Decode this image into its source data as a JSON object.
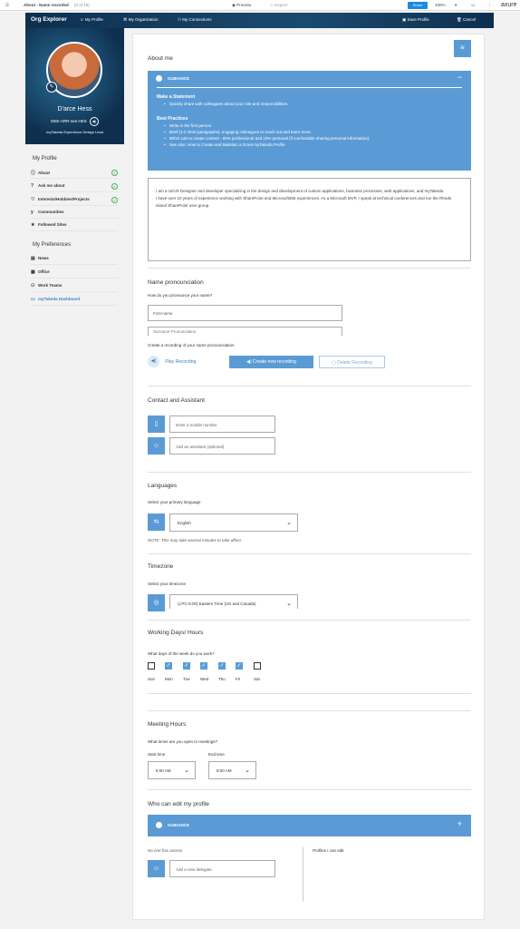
{
  "axure": {
    "page_title": "About - Name recorded",
    "page_count": "(3 of 16)",
    "preview": "Preview",
    "inspect": "Inspect",
    "share": "Share",
    "zoom": "100%",
    "logo": "axure"
  },
  "app": {
    "brand": "Org Explorer",
    "nav": [
      "My Profile",
      "My Organization",
      "My Connections"
    ],
    "save": "Save Profile",
    "cancel": "Cancel"
  },
  "profile": {
    "name": "D'arce Hess",
    "pronunciation": "DEE-ARR-see HES",
    "title": "myTakeda Experience Design Lead"
  },
  "sidebar": {
    "my_profile": "My Profile",
    "profile_items": [
      {
        "label": "About",
        "icon": "info-icon",
        "done": true
      },
      {
        "label": "Ask me about",
        "icon": "question-icon",
        "done": true
      },
      {
        "label": "Interests/Hobbies/Projects",
        "icon": "heart-icon",
        "done": true
      },
      {
        "label": "Communities",
        "icon": "yammer-icon",
        "done": false
      },
      {
        "label": "Followed Sites",
        "icon": "star-icon",
        "done": false
      }
    ],
    "my_preferences": "My Preferences",
    "pref_items": [
      {
        "label": "News",
        "icon": "news-icon"
      },
      {
        "label": "Office",
        "icon": "office-icon"
      },
      {
        "label": "Work Teams",
        "icon": "teams-icon"
      },
      {
        "label": "myTakeda Dashboard",
        "icon": "dashboard-icon"
      }
    ]
  },
  "about": {
    "heading": "About me",
    "guidance_title": "GUIDANCE",
    "make_statement": "Make a Statement",
    "statement_bullets": [
      "Quickly share with colleagues about your role and responsibilities."
    ],
    "best_practices": "Best Practices",
    "practice_bullets": [
      "Write in the first person.",
      "Brief (1-2 short paragraphs), engaging colleagues to reach out and learn more.",
      "90/10 rule to create content - 90% professional and 10% personal (if comfortable sharing personal information).",
      "See also: How to Create and Maintain a Great myTakeda Profile"
    ],
    "text": "I am a UI/UX Designer and developer specializing in the design and development of custom applications, business processes, web applications, and myTakeda.\nI have over 10 years of experience working with SharePoint and Microsoft365 experiences. As a Microsoft MVP, I speak at technical conferences and run the Rhode Island SharePoint user group."
  },
  "pronunciation": {
    "heading": "Name pronounciation",
    "question": "How do you pronounce your name?",
    "first_placeholder": "First-name",
    "surname_placeholder": "Surname-Pronunciation",
    "recording_label": "Create a recording of your name pronounciation",
    "play": "Play Recording",
    "create": "Create new recording",
    "delete": "Delete Recording"
  },
  "contact": {
    "heading": "Contact and Assistant",
    "mobile_placeholder": "Enter a mobile number",
    "assistant_placeholder": "Add an assistant (optional)"
  },
  "languages": {
    "heading": "Languages",
    "label": "Select your primary language",
    "value": "English",
    "note": "NOTE: This may take several minutes to take affect."
  },
  "timezone": {
    "heading": "Timezone",
    "label": "Select your timezone",
    "value": "(UTC-5:00) Eastern Time (US and Canada)"
  },
  "working": {
    "heading": "Working Days/ Hours",
    "question": "What days of the week do you work?",
    "days": [
      {
        "label": "Sun",
        "checked": false
      },
      {
        "label": "Mon",
        "checked": true
      },
      {
        "label": "Tue",
        "checked": true
      },
      {
        "label": "Wed",
        "checked": true
      },
      {
        "label": "Thu",
        "checked": true
      },
      {
        "label": "Fri",
        "checked": true
      },
      {
        "label": "Sat",
        "checked": false
      }
    ]
  },
  "meeting": {
    "heading": "Meeting Hours",
    "question": "What times are you open to meetings?",
    "start_label": "Start time",
    "start_value": "8:00 AM",
    "end_label": "End time",
    "end_value": "8:00 AM"
  },
  "editors": {
    "heading": "Who can edit my profile",
    "guidance_title": "GUIDANCE",
    "no_access": "No one has access",
    "delegate_placeholder": "Add a new delegate",
    "profiles_label": "Profiles I can edit"
  },
  "colors": {
    "accent": "#5b9bd5",
    "header": "#0d2f4f",
    "ok": "#4caf50"
  }
}
